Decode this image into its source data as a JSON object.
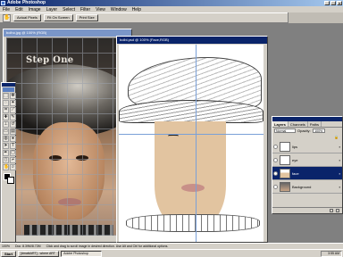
{
  "app": {
    "title": "Adobe Photoshop"
  },
  "menu": [
    "File",
    "Edit",
    "Image",
    "Layer",
    "Select",
    "Filter",
    "View",
    "Window",
    "Help"
  ],
  "options": {
    "buttons": [
      "Actual Pixels",
      "Fit On Screen",
      "Print Size"
    ]
  },
  "doc_back": {
    "title": "bolho.jpg @ 100% (RGB)",
    "overlay_text": "Step One",
    "status": "Doc: 8.39M/8.72M"
  },
  "doc_front": {
    "title": "bolbi.psd @ 100% (Face,RGB)"
  },
  "layers_panel": {
    "tabs": [
      "Layers",
      "Channels",
      "Paths"
    ],
    "blend_mode": "Normal",
    "opacity_label": "Opacity:",
    "opacity_value": "100%",
    "items": [
      {
        "name": "lips",
        "selected": false
      },
      {
        "name": "eye",
        "selected": false
      },
      {
        "name": "face",
        "selected": true
      },
      {
        "name": "Background",
        "selected": false
      }
    ]
  },
  "statusbar": {
    "zoom": "100%",
    "doc": "Doc: 8.39M/8.72M",
    "hint": "Click and drag to scroll image in desired direction. Use Alt and Ctrl for additional options."
  },
  "taskbar": {
    "start": "Start",
    "tasks": [
      "[dmatkART] - where ART",
      "Adobe Photoshop"
    ],
    "clock": "3:55 AM"
  },
  "colors": {
    "title_active": "#0a246a",
    "chrome": "#d4d0c8",
    "face_fill": "#e2c4a0",
    "lips_fill": "#c89088"
  }
}
